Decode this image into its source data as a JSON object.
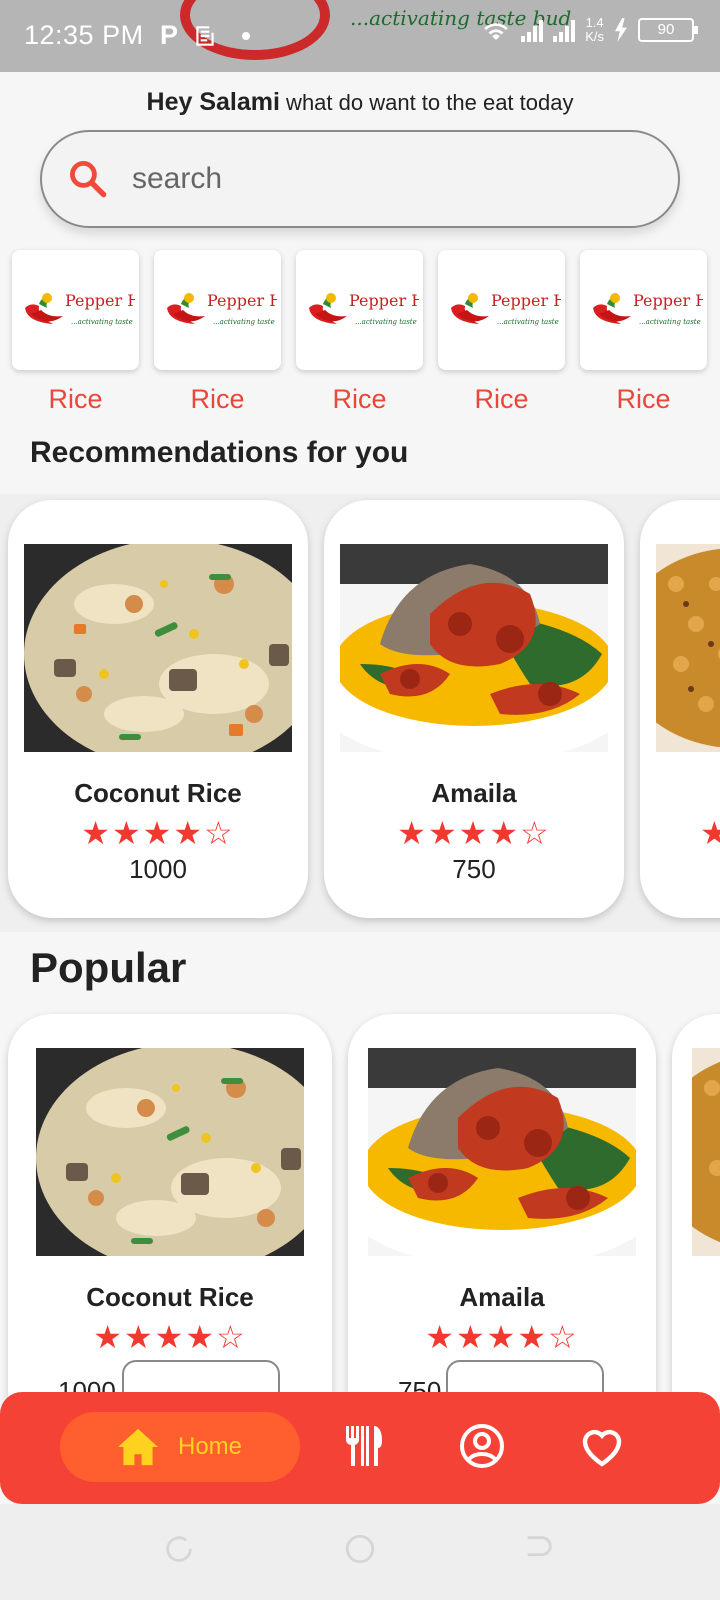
{
  "status_bar": {
    "time": "12:35 PM",
    "network_speed": "1.4\nK/s",
    "battery": "90"
  },
  "header": {
    "tagline": "...activating taste bud"
  },
  "greeting": {
    "name": "Hey Salami",
    "message": " what do  want to the eat today"
  },
  "search": {
    "placeholder": "search"
  },
  "categories": [
    {
      "label": "Rice",
      "brand": "Pepper House",
      "brand_tagline": "...activating taste buds"
    },
    {
      "label": "Rice",
      "brand": "Pepper House",
      "brand_tagline": "...activating taste buds"
    },
    {
      "label": "Rice",
      "brand": "Pepper House",
      "brand_tagline": "...activating taste buds"
    },
    {
      "label": "Rice",
      "brand": "Pepper House",
      "brand_tagline": "...activating taste buds"
    },
    {
      "label": "Rice",
      "brand": "Pepper House",
      "brand_tagline": "...activating taste buds"
    }
  ],
  "recommendations": {
    "title": "Recommendations for you",
    "items": [
      {
        "name": "Coconut Rice",
        "rating": 4,
        "max_rating": 5,
        "price": "1000"
      },
      {
        "name": "Amaila",
        "rating": 4,
        "max_rating": 5,
        "price": "750"
      }
    ]
  },
  "popular": {
    "title": "Popular",
    "items": [
      {
        "name": "Coconut Rice",
        "rating": 4,
        "max_rating": 5,
        "price": "1000"
      },
      {
        "name": "Amaila",
        "rating": 4,
        "max_rating": 5,
        "price": "750"
      }
    ]
  },
  "bottom_nav": {
    "home_label": "Home",
    "active": "home",
    "items": [
      "home-icon",
      "restaurant-icon",
      "account-icon",
      "favorite-icon"
    ]
  },
  "colors": {
    "accent": "#f44336",
    "home_pill": "#ff5f2e",
    "home_label": "#ffd21f",
    "category_label": "#e8473a",
    "star": "#f2392f"
  }
}
